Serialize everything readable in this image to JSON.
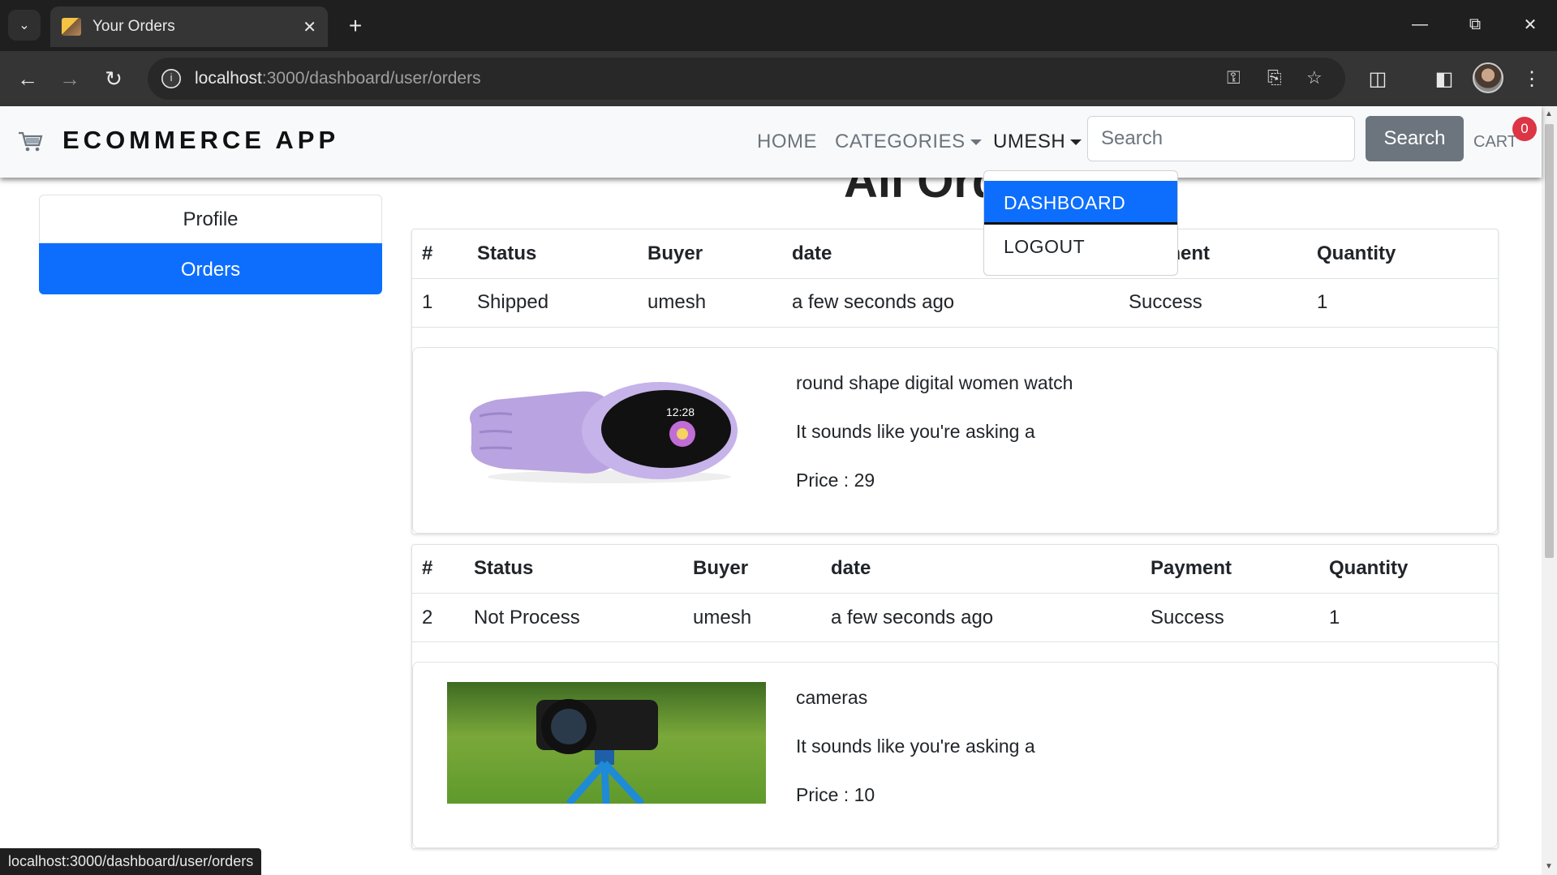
{
  "browser": {
    "tab_title": "Your Orders",
    "url_host": "localhost",
    "url_rest": ":3000/dashboard/user/orders",
    "status_url": "localhost:3000/dashboard/user/orders"
  },
  "navbar": {
    "brand": "ECOMMERCE APP",
    "home": "HOME",
    "categories": "CATEGORIES",
    "user": "UMESH",
    "search_placeholder": "Search",
    "search_button": "Search",
    "cart": "CART",
    "cart_count": "0"
  },
  "dropdown": {
    "items": [
      {
        "label": "DASHBOARD"
      },
      {
        "label": "LOGOUT"
      }
    ]
  },
  "page": {
    "title": "All Orders"
  },
  "sidebar": {
    "items": [
      {
        "label": "Profile"
      },
      {
        "label": "Orders"
      }
    ]
  },
  "orders": [
    {
      "headers": [
        "#",
        "Status",
        "Buyer",
        "date",
        "Payment",
        "Quantity"
      ],
      "row": [
        "1",
        "Shipped",
        "umesh",
        "a few seconds ago",
        "Success",
        "1"
      ],
      "product": {
        "name": "round shape digital women watch",
        "description": "It sounds like you're asking a",
        "price": "Price : 29",
        "image_time": "12:28"
      }
    },
    {
      "headers": [
        "#",
        "Status",
        "Buyer",
        "date",
        "Payment",
        "Quantity"
      ],
      "row": [
        "2",
        "Not Process",
        "umesh",
        "a few seconds ago",
        "Success",
        "1"
      ],
      "product": {
        "name": "cameras",
        "description": "It sounds like you're asking a",
        "price": "Price : 10"
      }
    }
  ],
  "colors": {
    "primary": "#0d6efd",
    "secondary": "#6c757d",
    "danger": "#dc3545"
  }
}
